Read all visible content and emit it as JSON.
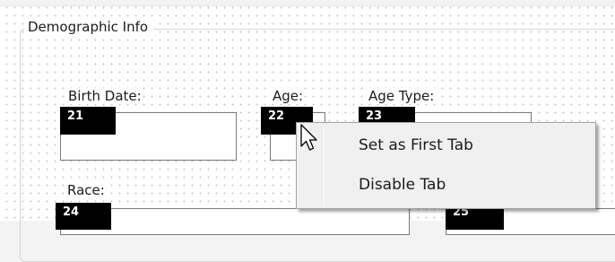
{
  "groupbox": {
    "title": "Demographic Info"
  },
  "fields": {
    "birth_date": {
      "label": "Birth Date:",
      "tab_index": "21"
    },
    "age": {
      "label": "Age:",
      "tab_index": "22"
    },
    "age_type": {
      "label": "Age Type:",
      "tab_index": "23"
    },
    "race": {
      "label": "Race:",
      "tab_index": "24"
    },
    "unlabeled": {
      "tab_index": "25"
    }
  },
  "context_menu": {
    "items": [
      {
        "label": "Set as First Tab"
      },
      {
        "label": "Disable Tab"
      }
    ]
  },
  "icons": {
    "cursor": "mouse-pointer-icon"
  },
  "colors": {
    "badge_bg": "#000000",
    "badge_text": "#ffffff",
    "menu_bg": "#f0f0f0"
  }
}
